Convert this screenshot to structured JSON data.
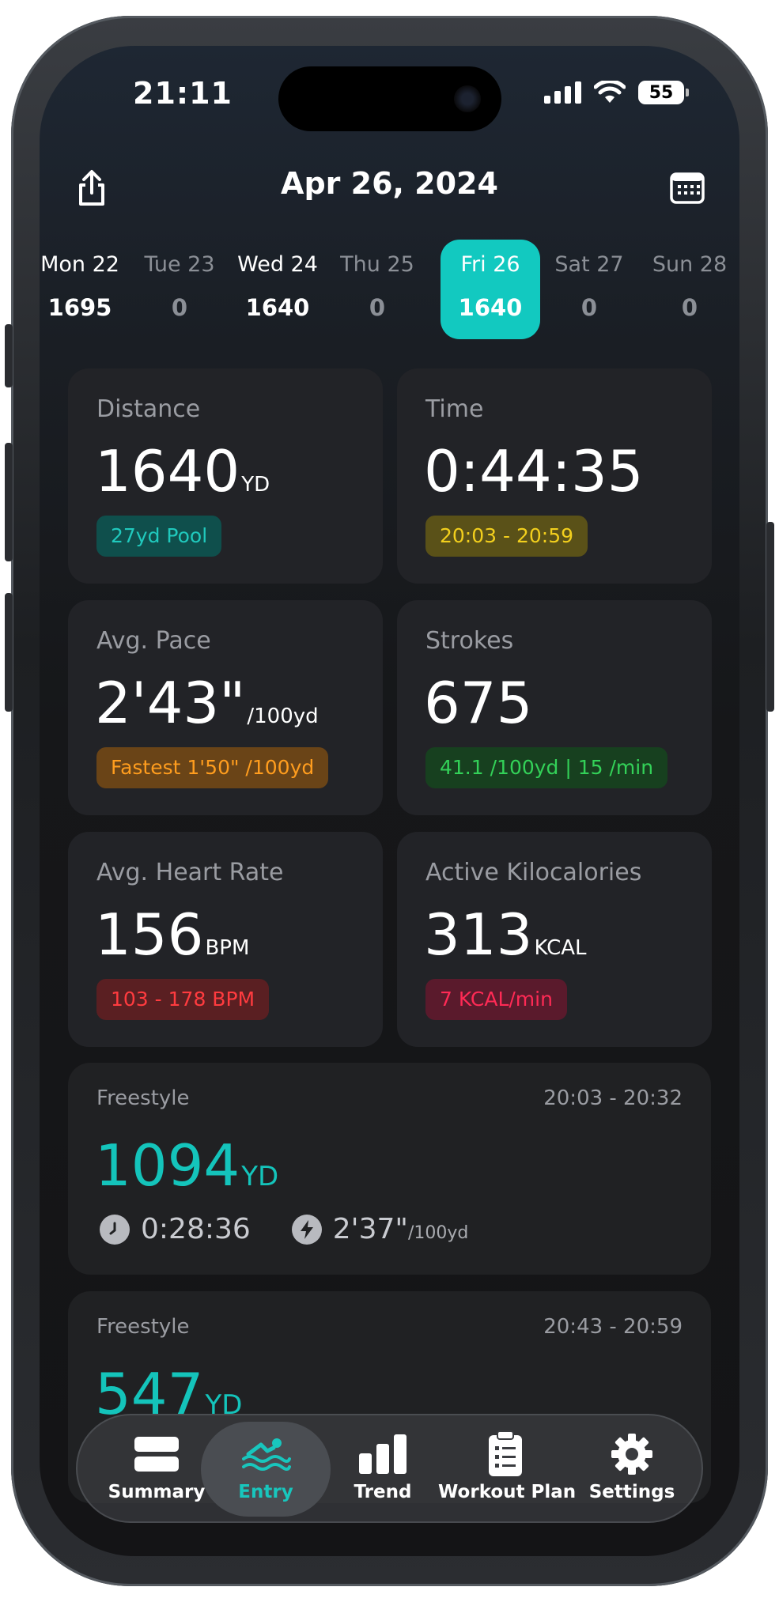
{
  "status": {
    "time": "21:11",
    "battery": "55"
  },
  "header": {
    "title": "Apr 26, 2024"
  },
  "week": [
    {
      "name": "Mon 22",
      "value": "1695",
      "has": true
    },
    {
      "name": "Tue 23",
      "value": "0",
      "has": false
    },
    {
      "name": "Wed 24",
      "value": "1640",
      "has": true
    },
    {
      "name": "Thu 25",
      "value": "0",
      "has": false
    },
    {
      "name": "Fri 26",
      "value": "1640",
      "has": true,
      "selected": true
    },
    {
      "name": "Sat 27",
      "value": "0",
      "has": false
    },
    {
      "name": "Sun 28",
      "value": "0",
      "has": false
    }
  ],
  "stats": {
    "distance": {
      "label": "Distance",
      "value": "1640",
      "unit": "YD",
      "chip": "27yd Pool"
    },
    "time": {
      "label": "Time",
      "value": "0:44:35",
      "chip": "20:03 - 20:59"
    },
    "pace": {
      "label": "Avg. Pace",
      "value": "2'43\"",
      "unit": "/100yd",
      "chip": "Fastest 1'50\" /100yd"
    },
    "strokes": {
      "label": "Strokes",
      "value": "675",
      "chip": "41.1 /100yd | 15 /min"
    },
    "heart": {
      "label": "Avg. Heart Rate",
      "value": "156",
      "unit": "BPM",
      "chip": "103 - 178 BPM"
    },
    "kcal": {
      "label": "Active Kilocalories",
      "value": "313",
      "unit": "KCAL",
      "chip": "7 KCAL/min"
    }
  },
  "intervals": [
    {
      "stroke": "Freestyle",
      "range": "20:03 - 20:32",
      "distance": "1094",
      "unit": "YD",
      "duration": "0:28:36",
      "pace": "2'37\"",
      "pace_unit": "/100yd"
    },
    {
      "stroke": "Freestyle",
      "range": "20:43 - 20:59",
      "distance": "547",
      "unit": "YD"
    }
  ],
  "tabs": {
    "summary": "Summary",
    "entry": "Entry",
    "trend": "Trend",
    "plan": "Workout Plan",
    "settings": "Settings"
  },
  "colors": {
    "accent": "#12c9c0",
    "pool_chip_bg": "#0f4f4c",
    "pool_chip_fg": "#20c9bd",
    "time_chip_bg": "#5a5118",
    "time_chip_fg": "#f2cf1d",
    "pace_chip_bg": "#6a4417",
    "pace_chip_fg": "#ff9d1e",
    "strokes_chip_bg": "#17401f",
    "strokes_chip_fg": "#33d158",
    "hr_chip_bg": "#5a1f22",
    "hr_chip_fg": "#ff3b3f",
    "kcal_chip_bg": "#5a1a2c",
    "kcal_chip_fg": "#ff2a55"
  }
}
